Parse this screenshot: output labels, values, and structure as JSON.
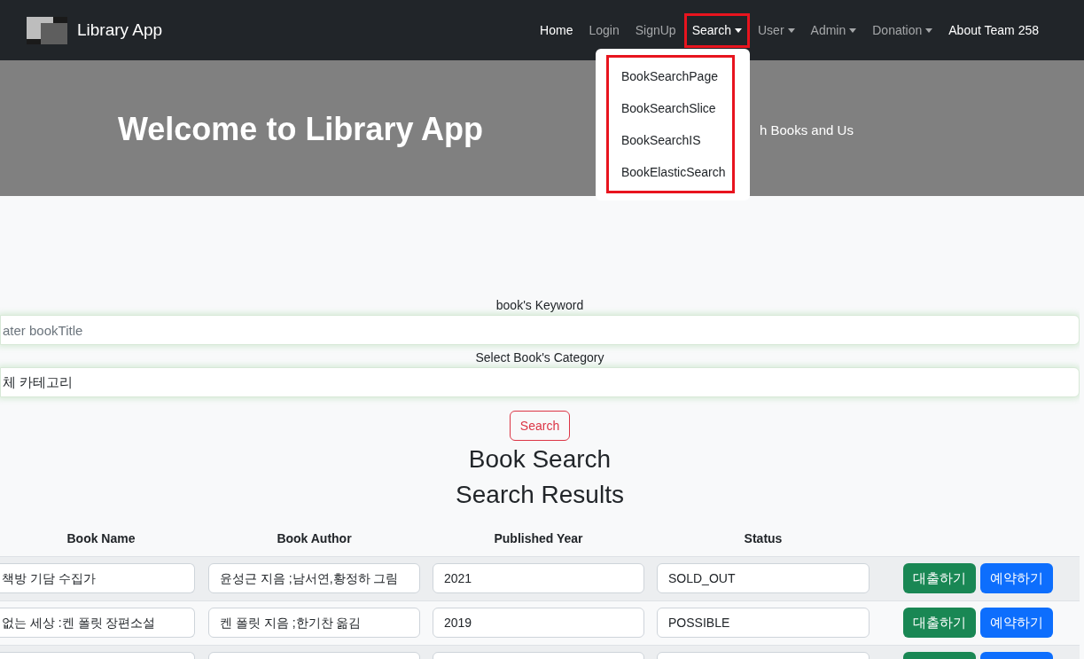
{
  "navbar": {
    "brand": "Library App",
    "items": [
      {
        "label": "Home",
        "active": true,
        "dropdown": false,
        "highlighted": false
      },
      {
        "label": "Login",
        "active": false,
        "dropdown": false,
        "highlighted": false
      },
      {
        "label": "SignUp",
        "active": false,
        "dropdown": false,
        "highlighted": false
      },
      {
        "label": "Search",
        "active": true,
        "dropdown": true,
        "highlighted": true,
        "menu": [
          "BookSearchPage",
          "BookSearchSlice",
          "BookSearchIS",
          "BookElasticSearch"
        ],
        "menu_highlighted": true
      },
      {
        "label": "User",
        "active": false,
        "dropdown": true,
        "highlighted": false
      },
      {
        "label": "Admin",
        "active": false,
        "dropdown": true,
        "highlighted": false
      },
      {
        "label": "Donation",
        "active": false,
        "dropdown": true,
        "highlighted": false
      },
      {
        "label": "About Team 258",
        "active": true,
        "dropdown": false,
        "highlighted": false
      }
    ]
  },
  "hero": {
    "title": "Welcome to Library App",
    "subtitle": "h Books and Us"
  },
  "search_form": {
    "keyword_label": "book's Keyword",
    "keyword_placeholder": "ater bookTitle",
    "category_label": "Select Book's Category",
    "category_value": "체 카테고리",
    "button": "Search"
  },
  "headings": [
    "Book Search",
    "Search Results"
  ],
  "table": {
    "columns": [
      "Book Name",
      "Book Author",
      "Published Year",
      "Status"
    ],
    "rows": [
      {
        "name": "책방 기담 수집가",
        "author": "윤성근 지음 ;남서연,황정하 그림",
        "year": "2021",
        "status": "SOLD_OUT",
        "actions": [
          "대출하기",
          "예약하기"
        ]
      },
      {
        "name": "없는 세상 :켄 폴릿 장편소설",
        "author": "켄 폴릿 지음 ;한기찬 옮김",
        "year": "2019",
        "status": "POSSIBLE",
        "actions": [
          "대출하기",
          "예약하기"
        ]
      },
      {}
    ]
  }
}
